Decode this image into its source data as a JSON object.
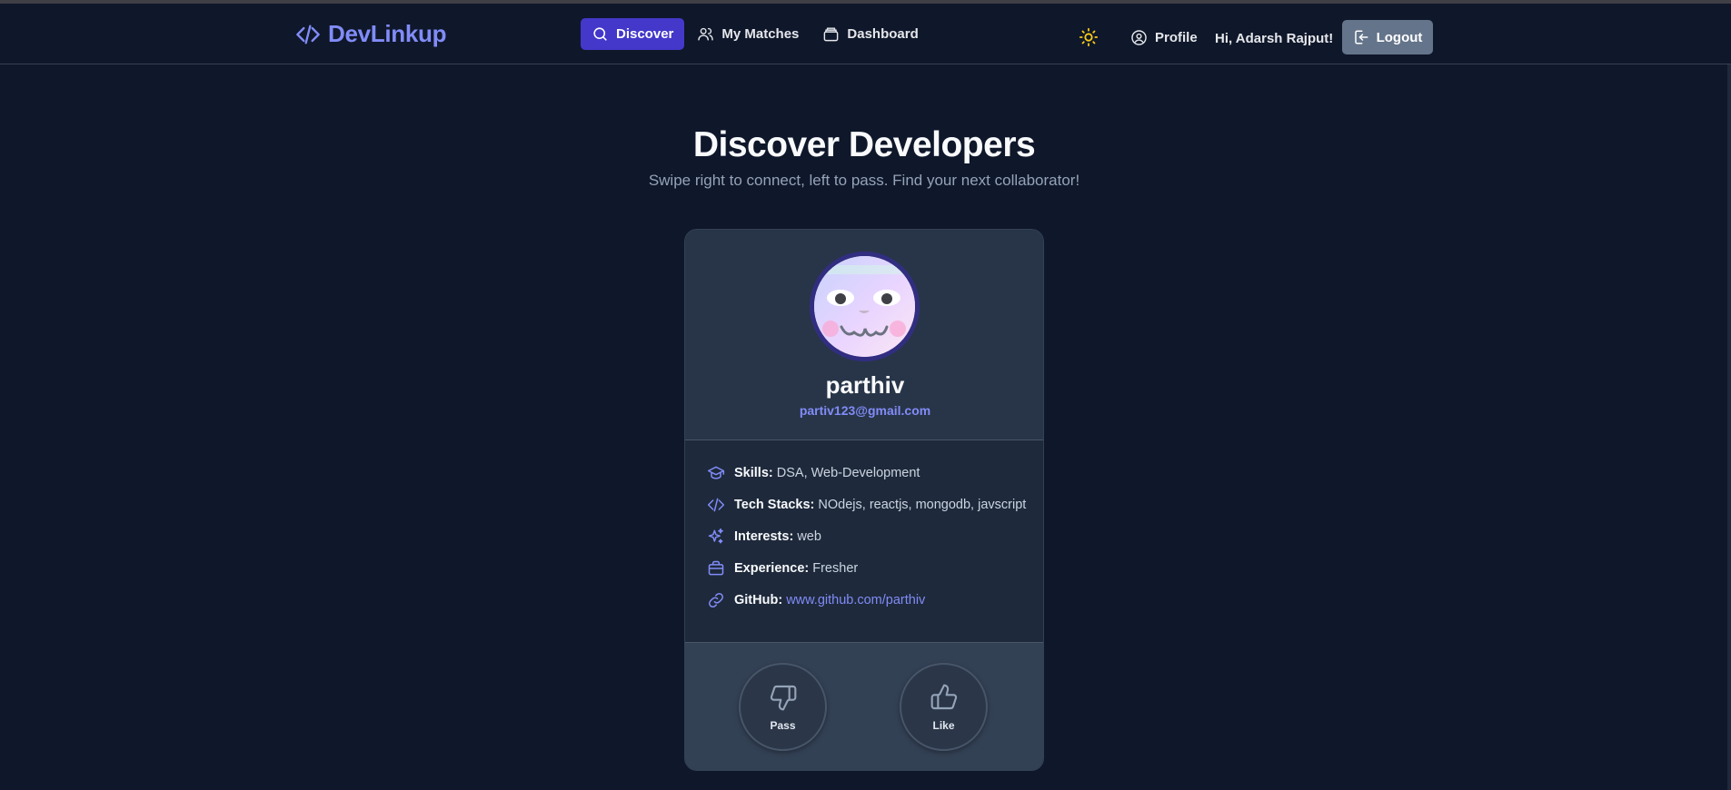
{
  "app": {
    "brand": "DevLinkup"
  },
  "nav": {
    "items": [
      {
        "label": "Discover",
        "icon": "search-icon",
        "active": true
      },
      {
        "label": "My Matches",
        "icon": "users-icon",
        "active": false
      },
      {
        "label": "Dashboard",
        "icon": "layers-icon",
        "active": false
      }
    ],
    "theme_icon": "sun-icon",
    "profile_label": "Profile",
    "greeting": "Hi, Adarsh Rajput!",
    "logout_label": "Logout"
  },
  "page": {
    "title": "Discover Developers",
    "subtitle": "Swipe right to connect, left to pass. Find your next collaborator!"
  },
  "profile_card": {
    "name": "parthiv",
    "email": "partiv123@gmail.com",
    "details": [
      {
        "label": "Skills:",
        "value": "DSA, Web-Development",
        "icon": "graduation-cap-icon"
      },
      {
        "label": "Tech Stacks:",
        "value": "NOdejs, reactjs, mongodb, javscript",
        "icon": "code-icon"
      },
      {
        "label": "Interests:",
        "value": "web",
        "icon": "sparkles-icon"
      },
      {
        "label": "Experience:",
        "value": "Fresher",
        "icon": "briefcase-icon"
      },
      {
        "label": "GitHub:",
        "value": "www.github.com/parthiv",
        "icon": "link-icon"
      }
    ],
    "actions": {
      "pass_label": "Pass",
      "like_label": "Like"
    }
  },
  "colors": {
    "accent": "#818cf8",
    "active_nav": "#4338ca",
    "background": "#0f172a",
    "logout": "#64748b"
  }
}
